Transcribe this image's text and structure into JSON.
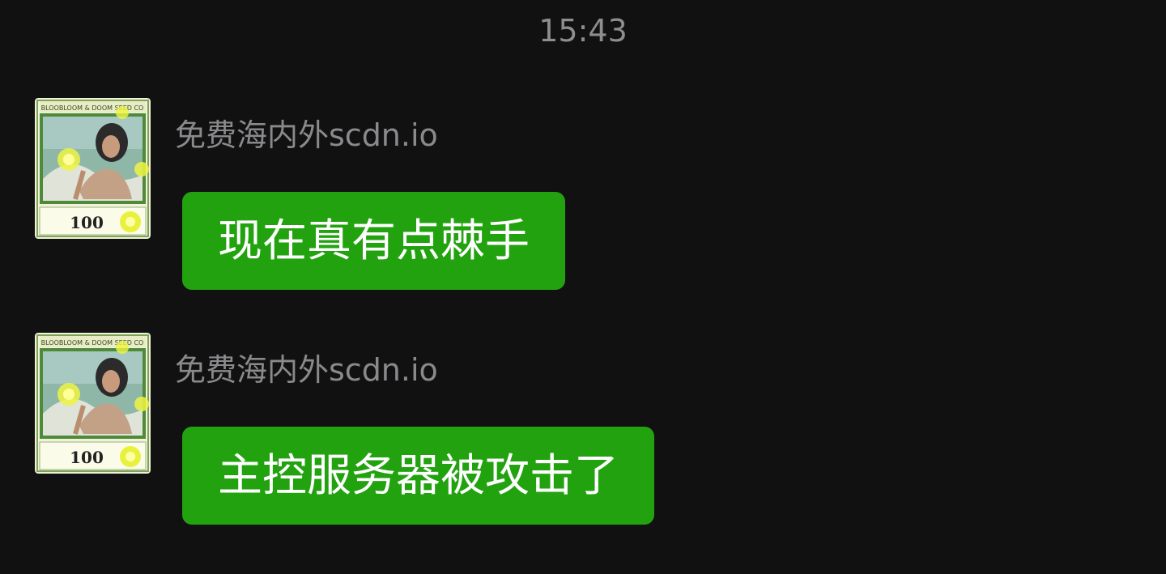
{
  "status": {
    "time": "15:43"
  },
  "messages": [
    {
      "sender": "免费海内外scdn.io",
      "text": "现在真有点棘手",
      "avatar": {
        "banner": "BLOOBLOOM & DOOM SEED CO",
        "value": "100"
      }
    },
    {
      "sender": "免费海内外scdn.io",
      "text": "主控服务器被攻击了",
      "avatar": {
        "banner": "BLOOBLOOM & DOOM SEED CO",
        "value": "100"
      }
    }
  ],
  "colors": {
    "background": "#111112",
    "bubble": "#22a20f",
    "bubble_text": "#ffffff",
    "sender_text": "#8a8a8c",
    "timestamp_text": "#8e8e90"
  }
}
